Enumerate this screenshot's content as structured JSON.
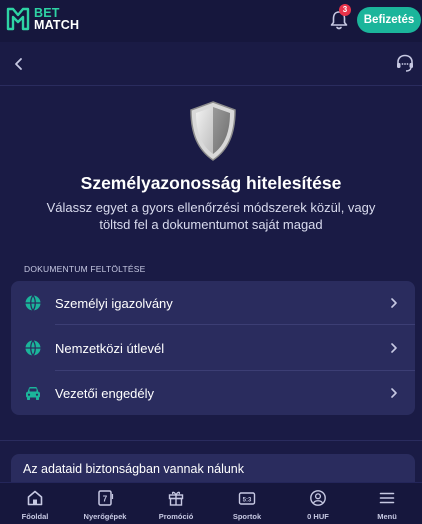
{
  "header": {
    "logo_line1": "BET",
    "logo_line2": "MATCH",
    "notification_count": "3",
    "pay_button_label": "Befizetés"
  },
  "page": {
    "title": "Személyazonosság hitelesítése",
    "subtitle": "Válassz egyet a gyors ellenőrzési módszerek közül, vagy töltsd fel a dokumentumot saját magad",
    "section_label": "DOKUMENTUM FELTÖLTÉSE",
    "documents": [
      {
        "label": "Személyi igazolvány",
        "icon": "globe-icon"
      },
      {
        "label": "Nemzetközi útlevél",
        "icon": "globe-icon"
      },
      {
        "label": "Vezetői engedély",
        "icon": "car-icon"
      }
    ],
    "info_text": "Az adataid biztonságban vannak nálunk"
  },
  "bottom_nav": [
    {
      "label": "Főoldal",
      "icon": "home-icon"
    },
    {
      "label": "Nyerőgépek",
      "icon": "slot-machine-icon"
    },
    {
      "label": "Promóció",
      "icon": "gift-icon"
    },
    {
      "label": "Sportok",
      "icon": "scoreboard-icon"
    },
    {
      "label": "0 HUF",
      "icon": "user-icon"
    },
    {
      "label": "Menü",
      "icon": "menu-icon"
    }
  ],
  "colors": {
    "background": "#1a1b45",
    "card": "#2a2c5e",
    "accent": "#1bb59b",
    "brand_green": "#2ed3a4",
    "badge": "#e8334a"
  }
}
